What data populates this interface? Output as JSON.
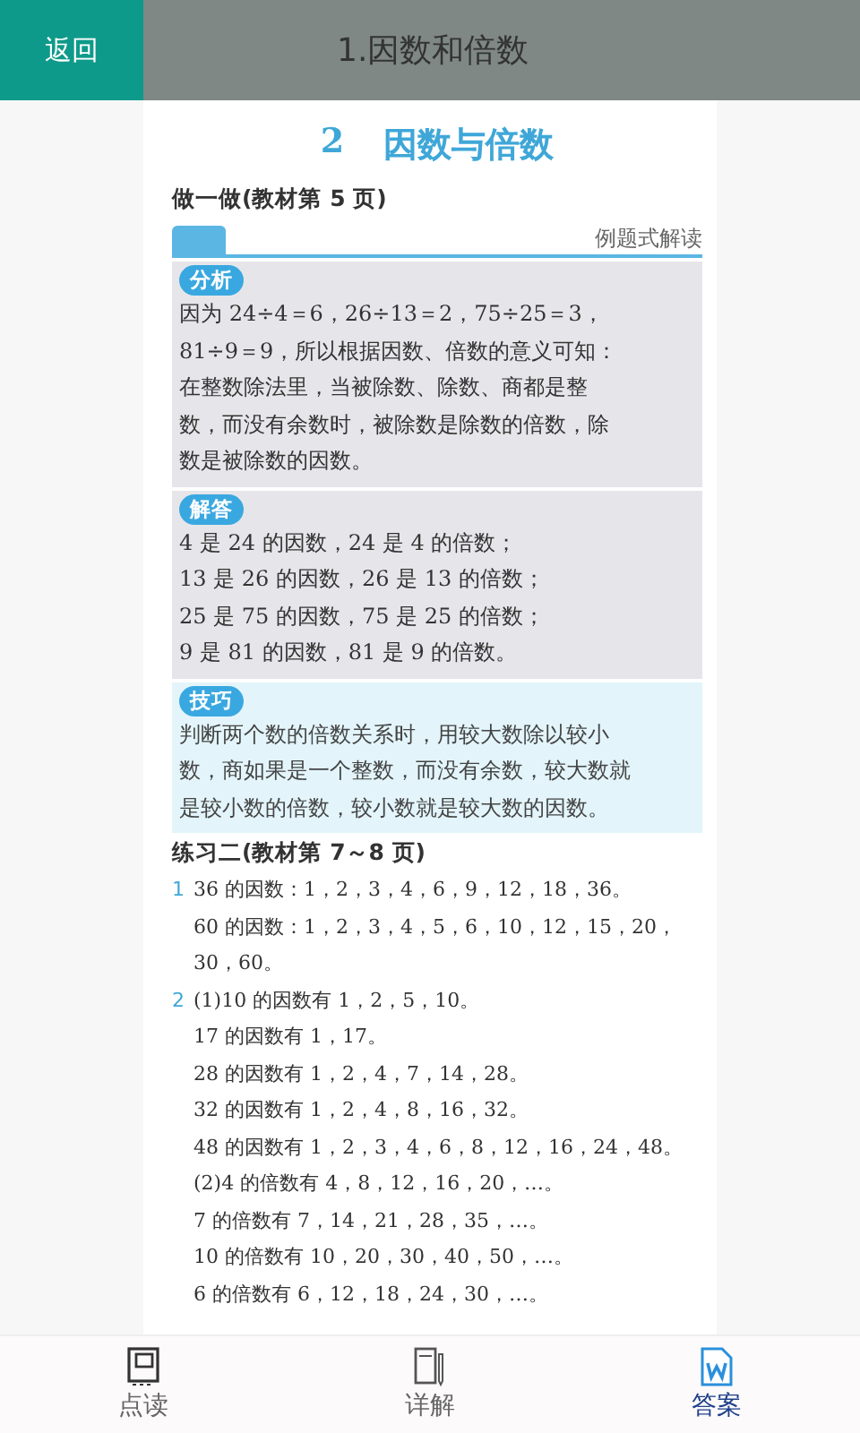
{
  "header": {
    "back_button": "返回",
    "title": "1.因数和倍数"
  },
  "page": {
    "title_number": "2",
    "title": "因数与倍数",
    "exercise_heading": "做一做(教材第 5 页)",
    "banner": "例题式解读",
    "blocks": [
      {
        "badge": "分析",
        "kind": "gray",
        "lines": [
          "因为 24÷4＝6，26÷13＝2，75÷25＝3，",
          "81÷9＝9，所以根据因数、倍数的意义可知：",
          "在整数除法里，当被除数、除数、商都是整",
          "数，而没有余数时，被除数是除数的倍数，除",
          "数是被除数的因数。"
        ]
      },
      {
        "badge": "解答",
        "kind": "gray",
        "lines": [
          "4 是 24 的因数，24 是 4 的倍数；",
          "13 是 26 的因数，26 是 13 的倍数；",
          "25 是 75 的因数，75 是 25 的倍数；",
          "9 是 81 的因数，81 是 9 的倍数。"
        ]
      },
      {
        "badge": "技巧",
        "kind": "blue",
        "lines": [
          "判断两个数的倍数关系时，用较大数除以较小",
          "数，商如果是一个整数，而没有余数，较大数就",
          "是较小数的倍数，较小数就是较大数的因数。"
        ]
      }
    ],
    "practice_heading": "练习二(教材第 7～8 页)",
    "questions": [
      {
        "number": "1",
        "lines": [
          "36 的因数：1，2，3，4，6，9，12，18，36。",
          "60 的因数：1，2，3，4，5，6，10，12，15，20，",
          "30，60。"
        ]
      },
      {
        "number": "2",
        "lines": [
          "(1)10 的因数有 1，2，5，10。",
          "17 的因数有 1，17。",
          "28 的因数有 1，2，4，7，14，28。",
          "32 的因数有 1，2，4，8，16，32。",
          "48 的因数有 1，2，3，4，6，8，12，16，24，48。",
          "(2)4 的倍数有 4，8，12，16，20，…。",
          "7 的倍数有 7，14，21，28，35，…。",
          "10 的倍数有 10，20，30，40，50，…。",
          "6 的倍数有 6，12，18，24，30，…。"
        ]
      }
    ]
  },
  "tabs": [
    {
      "label": "点读",
      "kind": "book",
      "selected": false
    },
    {
      "label": "详解",
      "kind": "notebook",
      "selected": false
    },
    {
      "label": "答案",
      "kind": "document",
      "selected": true
    }
  ]
}
